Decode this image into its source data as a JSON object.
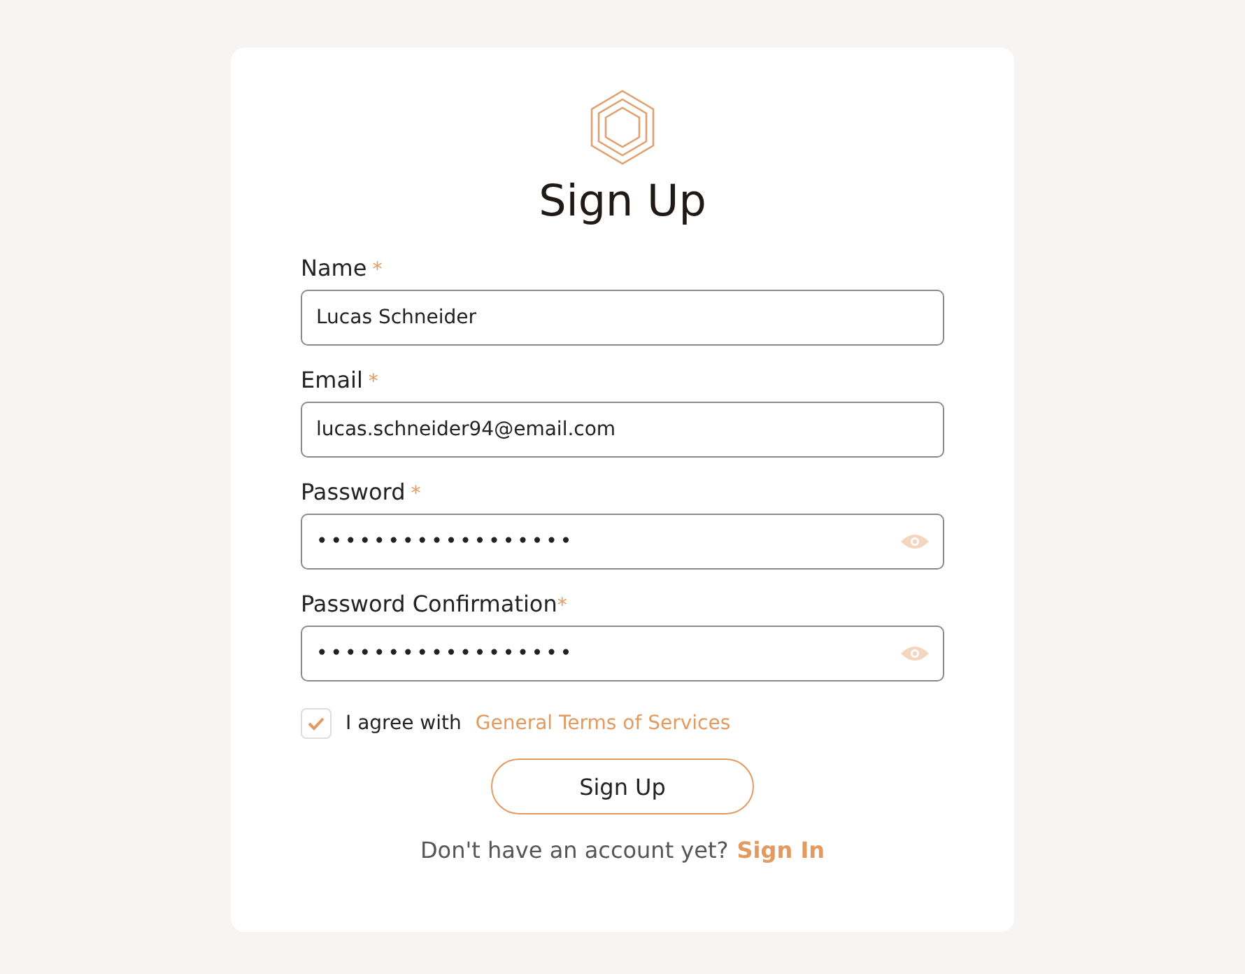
{
  "title": "Sign Up",
  "fields": [
    {
      "label": "Name",
      "marker": "*",
      "value": "Lucas Schneider",
      "kind": "text"
    },
    {
      "label": "Email",
      "marker": "*",
      "value": "lucas.schneider94@email.com",
      "kind": "text"
    },
    {
      "label": "Password",
      "marker": "*",
      "value": "••••••••••••••••••",
      "kind": "password"
    },
    {
      "label": "Password Confirmation",
      "marker": "*",
      "value": "••••••••••••••••••",
      "kind": "password"
    }
  ],
  "agree": {
    "checked": true,
    "text": "I agree with",
    "link": "General Terms of Services"
  },
  "submit": "Sign Up",
  "footer": {
    "text": "Don't have an account yet?",
    "link": "Sign In"
  }
}
